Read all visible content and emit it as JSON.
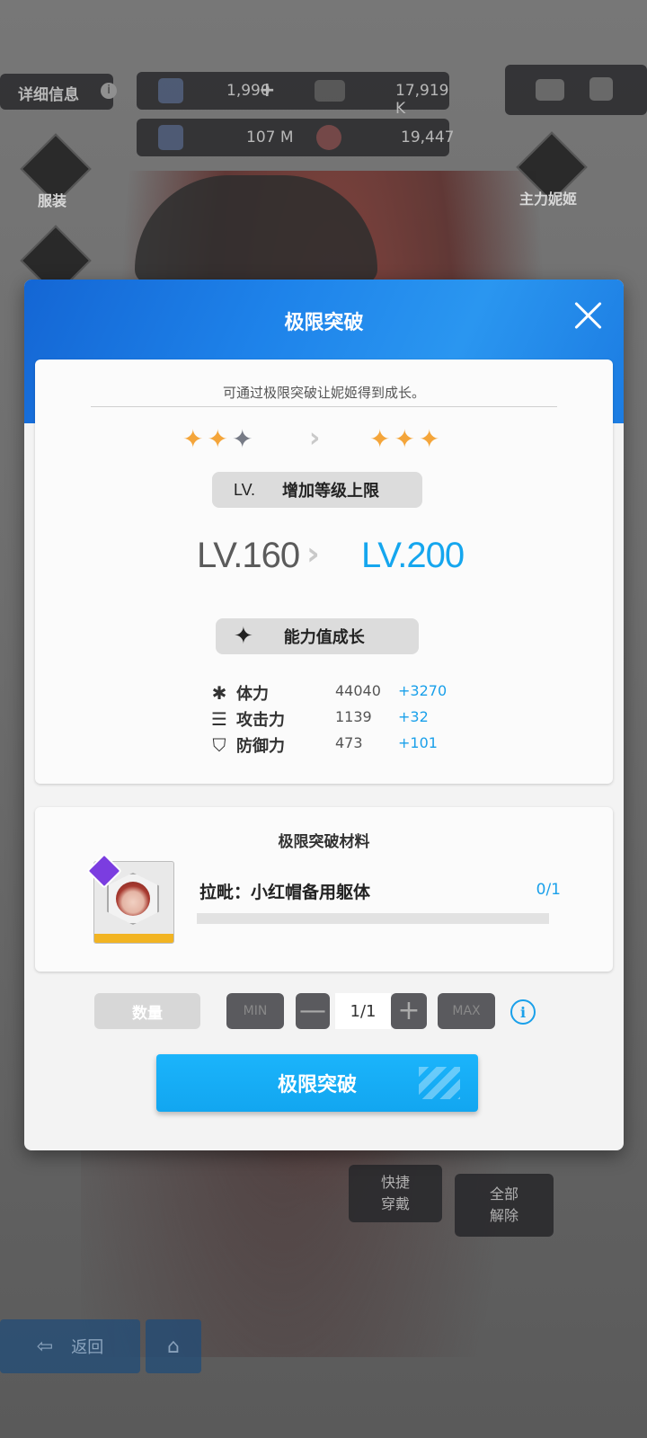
{
  "hud": {
    "detail_label": "详细信息",
    "info_glyph": "i",
    "gems": "1,990",
    "gems_plus": "+",
    "credits": "17,919 K",
    "battle_data": "107 M",
    "core_dust": "19,447",
    "costume_label": "服装",
    "main_nikke_label": "主力妮姬",
    "quick_equip_label": "快捷\n穿戴",
    "unequip_all_label": "全部\n解除",
    "back_label": "返回"
  },
  "modal": {
    "title": "极限突破",
    "description": "可通过极限突破让妮姬得到成长。",
    "stars_before": [
      "on",
      "on",
      "off"
    ],
    "stars_after": [
      "on",
      "on",
      "on"
    ],
    "arrow_glyph": "›",
    "level_section": {
      "prefix": "LV.",
      "label": "增加等级上限"
    },
    "level_old": "LV.160",
    "level_new": "LV.200",
    "growth_section": {
      "icon": "four-point-star-icon",
      "label": "能力值成长"
    },
    "stats": [
      {
        "icon": "asterisk-icon",
        "glyph": "✱",
        "name": "体力",
        "value": "44040",
        "add": "+3270"
      },
      {
        "icon": "bullets-icon",
        "glyph": "☰",
        "name": "攻击力",
        "value": "1139",
        "add": "+32"
      },
      {
        "icon": "shield-icon",
        "glyph": "⛉",
        "name": "防御力",
        "value": "473",
        "add": "+101"
      }
    ],
    "material": {
      "title": "极限突破材料",
      "name": "拉毗：小红帽备用躯体",
      "count": "0/1",
      "progress": 0
    },
    "quantity": {
      "label": "数量",
      "min_label": "MIN",
      "minus_glyph": "—",
      "value": "1/1",
      "plus_glyph": "+",
      "max_label": "MAX",
      "info_glyph": "i"
    },
    "confirm_label": "极限突破"
  },
  "colors": {
    "accent_blue": "#1aa0ea",
    "header_blue": "#1e83ea",
    "star_gold": "#f4a53a",
    "star_gray": "#777b86"
  }
}
